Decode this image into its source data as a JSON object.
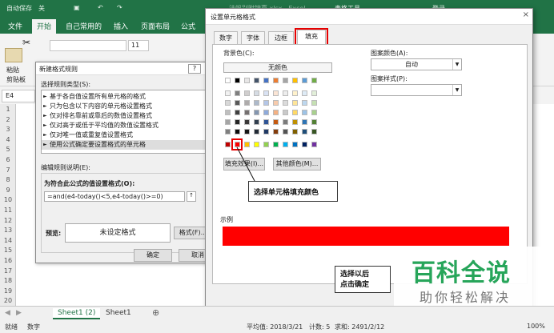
{
  "titlebar": {
    "autosave": "自动保存",
    "autosave_state": "关",
    "filename": "法帆别附锦嘉.xlsx - Excel",
    "tools": "表格工具",
    "login": "登录"
  },
  "ribbon": {
    "tabs": [
      "文件",
      "开始",
      "自己常用的",
      "插入",
      "页面布局",
      "公式"
    ],
    "active_tab": "开始",
    "paste": "粘贴",
    "clipboard": "剪贴板",
    "font_size": "11"
  },
  "namebox": "E4",
  "rows": [
    "1",
    "2",
    "3",
    "4",
    "5",
    "6",
    "7",
    "8",
    "9",
    "10",
    "11",
    "12",
    "13",
    "14",
    "15",
    "16",
    "17",
    "18",
    "19",
    "20"
  ],
  "rule_dialog": {
    "title": "新建格式规则",
    "help": "?",
    "section_type": "选择规则类型(S):",
    "rule_types": [
      "基于各自值设置所有单元格的格式",
      "只为包含以下内容的单元格设置格式",
      "仅对排名靠前或靠后的数值设置格式",
      "仅对高于或低于平均值的数值设置格式",
      "仅对唯一值或重复值设置格式",
      "使用公式确定要设置格式的单元格"
    ],
    "section_edit": "编辑规则说明(E):",
    "formula_label": "为符合此公式的值设置格式(O):",
    "formula": "=and(e4-today()<5,e4-today()>=0)",
    "preview_label": "预览:",
    "preview_text": "未设定格式",
    "format_button": "格式(F)...",
    "ok": "确定",
    "cancel": "取消"
  },
  "format_dialog": {
    "title": "设置单元格格式",
    "close": "×",
    "tabs": [
      "数字",
      "字体",
      "边框",
      "填充"
    ],
    "active_tab": "填充",
    "bg_label": "背景色(C):",
    "no_color": "无颜色",
    "pattern_color_label": "图案颜色(A):",
    "pattern_color_value": "自动",
    "pattern_style_label": "图案样式(P):",
    "fill_effects": "填充效果(I)...",
    "more_colors": "其他颜色(M)...",
    "sample_label": "示例",
    "sample_color": "#ff0000",
    "selected_color": "#c00000"
  },
  "callouts": {
    "select_fill": "选择单元格填充颜色",
    "click_ok": "选择以后\n点击确定"
  },
  "watermark": {
    "line1": "百科全说",
    "line2": "助你轻松解决"
  },
  "sheet_tabs": [
    "Sheet1 (2)",
    "Sheet1"
  ],
  "active_sheet": "Sheet1 (2)",
  "status": {
    "mode": "就绪",
    "digit": "数字",
    "average": "平均值: 2018/3/21",
    "count": "计数: 5",
    "sum": "求和: 2491/2/12",
    "zoom": "100%"
  },
  "palette": {
    "row1": [
      "#ffffff",
      "#000000",
      "#e7e6e6",
      "#44546a",
      "#4472c4",
      "#ed7d31",
      "#a5a5a5",
      "#ffc000",
      "#5b9bd5",
      "#70ad47"
    ],
    "shades": [
      [
        "#f2f2f2",
        "#7f7f7f",
        "#d0cece",
        "#d6dce4",
        "#d9e2f3",
        "#fbe5d5",
        "#ededed",
        "#fff2cc",
        "#deebf6",
        "#e2efd9"
      ],
      [
        "#d8d8d8",
        "#595959",
        "#aeabab",
        "#adb9ca",
        "#b4c6e7",
        "#f7cbac",
        "#dbdbdb",
        "#fee599",
        "#bdd7ee",
        "#c5e0b3"
      ],
      [
        "#bfbfbf",
        "#3f3f3f",
        "#757070",
        "#8496b0",
        "#8eaadb",
        "#f4b183",
        "#c9c9c9",
        "#ffd965",
        "#9dc3e6",
        "#a8d08d"
      ],
      [
        "#a5a5a5",
        "#262626",
        "#3a3838",
        "#323f4f",
        "#2f5496",
        "#c55a11",
        "#7b7b7b",
        "#bf9000",
        "#2e75b5",
        "#538135"
      ],
      [
        "#7f7f7f",
        "#0c0c0c",
        "#171616",
        "#222a35",
        "#1f3864",
        "#833c0b",
        "#525252",
        "#7f6000",
        "#1e4e79",
        "#375623"
      ]
    ],
    "standard": [
      "#c00000",
      "#ff0000",
      "#ffc000",
      "#ffff00",
      "#92d050",
      "#00b050",
      "#00b0f0",
      "#0070c0",
      "#002060",
      "#7030a0"
    ]
  }
}
